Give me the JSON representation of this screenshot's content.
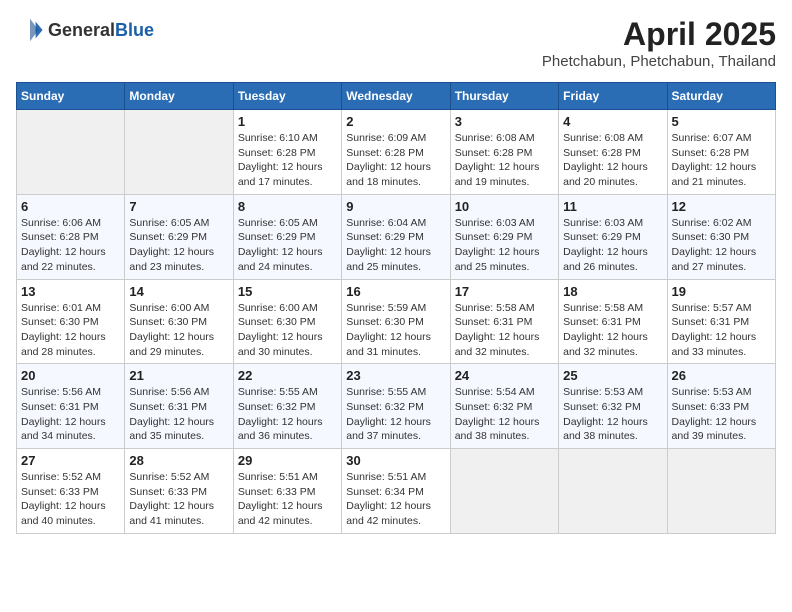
{
  "header": {
    "logo_general": "General",
    "logo_blue": "Blue",
    "title": "April 2025",
    "subtitle": "Phetchabun, Phetchabun, Thailand"
  },
  "calendar": {
    "weekdays": [
      "Sunday",
      "Monday",
      "Tuesday",
      "Wednesday",
      "Thursday",
      "Friday",
      "Saturday"
    ],
    "weeks": [
      [
        {
          "day": "",
          "sunrise": "",
          "sunset": "",
          "daylight": ""
        },
        {
          "day": "",
          "sunrise": "",
          "sunset": "",
          "daylight": ""
        },
        {
          "day": "1",
          "sunrise": "Sunrise: 6:10 AM",
          "sunset": "Sunset: 6:28 PM",
          "daylight": "Daylight: 12 hours and 17 minutes."
        },
        {
          "day": "2",
          "sunrise": "Sunrise: 6:09 AM",
          "sunset": "Sunset: 6:28 PM",
          "daylight": "Daylight: 12 hours and 18 minutes."
        },
        {
          "day": "3",
          "sunrise": "Sunrise: 6:08 AM",
          "sunset": "Sunset: 6:28 PM",
          "daylight": "Daylight: 12 hours and 19 minutes."
        },
        {
          "day": "4",
          "sunrise": "Sunrise: 6:08 AM",
          "sunset": "Sunset: 6:28 PM",
          "daylight": "Daylight: 12 hours and 20 minutes."
        },
        {
          "day": "5",
          "sunrise": "Sunrise: 6:07 AM",
          "sunset": "Sunset: 6:28 PM",
          "daylight": "Daylight: 12 hours and 21 minutes."
        }
      ],
      [
        {
          "day": "6",
          "sunrise": "Sunrise: 6:06 AM",
          "sunset": "Sunset: 6:28 PM",
          "daylight": "Daylight: 12 hours and 22 minutes."
        },
        {
          "day": "7",
          "sunrise": "Sunrise: 6:05 AM",
          "sunset": "Sunset: 6:29 PM",
          "daylight": "Daylight: 12 hours and 23 minutes."
        },
        {
          "day": "8",
          "sunrise": "Sunrise: 6:05 AM",
          "sunset": "Sunset: 6:29 PM",
          "daylight": "Daylight: 12 hours and 24 minutes."
        },
        {
          "day": "9",
          "sunrise": "Sunrise: 6:04 AM",
          "sunset": "Sunset: 6:29 PM",
          "daylight": "Daylight: 12 hours and 25 minutes."
        },
        {
          "day": "10",
          "sunrise": "Sunrise: 6:03 AM",
          "sunset": "Sunset: 6:29 PM",
          "daylight": "Daylight: 12 hours and 25 minutes."
        },
        {
          "day": "11",
          "sunrise": "Sunrise: 6:03 AM",
          "sunset": "Sunset: 6:29 PM",
          "daylight": "Daylight: 12 hours and 26 minutes."
        },
        {
          "day": "12",
          "sunrise": "Sunrise: 6:02 AM",
          "sunset": "Sunset: 6:30 PM",
          "daylight": "Daylight: 12 hours and 27 minutes."
        }
      ],
      [
        {
          "day": "13",
          "sunrise": "Sunrise: 6:01 AM",
          "sunset": "Sunset: 6:30 PM",
          "daylight": "Daylight: 12 hours and 28 minutes."
        },
        {
          "day": "14",
          "sunrise": "Sunrise: 6:00 AM",
          "sunset": "Sunset: 6:30 PM",
          "daylight": "Daylight: 12 hours and 29 minutes."
        },
        {
          "day": "15",
          "sunrise": "Sunrise: 6:00 AM",
          "sunset": "Sunset: 6:30 PM",
          "daylight": "Daylight: 12 hours and 30 minutes."
        },
        {
          "day": "16",
          "sunrise": "Sunrise: 5:59 AM",
          "sunset": "Sunset: 6:30 PM",
          "daylight": "Daylight: 12 hours and 31 minutes."
        },
        {
          "day": "17",
          "sunrise": "Sunrise: 5:58 AM",
          "sunset": "Sunset: 6:31 PM",
          "daylight": "Daylight: 12 hours and 32 minutes."
        },
        {
          "day": "18",
          "sunrise": "Sunrise: 5:58 AM",
          "sunset": "Sunset: 6:31 PM",
          "daylight": "Daylight: 12 hours and 32 minutes."
        },
        {
          "day": "19",
          "sunrise": "Sunrise: 5:57 AM",
          "sunset": "Sunset: 6:31 PM",
          "daylight": "Daylight: 12 hours and 33 minutes."
        }
      ],
      [
        {
          "day": "20",
          "sunrise": "Sunrise: 5:56 AM",
          "sunset": "Sunset: 6:31 PM",
          "daylight": "Daylight: 12 hours and 34 minutes."
        },
        {
          "day": "21",
          "sunrise": "Sunrise: 5:56 AM",
          "sunset": "Sunset: 6:31 PM",
          "daylight": "Daylight: 12 hours and 35 minutes."
        },
        {
          "day": "22",
          "sunrise": "Sunrise: 5:55 AM",
          "sunset": "Sunset: 6:32 PM",
          "daylight": "Daylight: 12 hours and 36 minutes."
        },
        {
          "day": "23",
          "sunrise": "Sunrise: 5:55 AM",
          "sunset": "Sunset: 6:32 PM",
          "daylight": "Daylight: 12 hours and 37 minutes."
        },
        {
          "day": "24",
          "sunrise": "Sunrise: 5:54 AM",
          "sunset": "Sunset: 6:32 PM",
          "daylight": "Daylight: 12 hours and 38 minutes."
        },
        {
          "day": "25",
          "sunrise": "Sunrise: 5:53 AM",
          "sunset": "Sunset: 6:32 PM",
          "daylight": "Daylight: 12 hours and 38 minutes."
        },
        {
          "day": "26",
          "sunrise": "Sunrise: 5:53 AM",
          "sunset": "Sunset: 6:33 PM",
          "daylight": "Daylight: 12 hours and 39 minutes."
        }
      ],
      [
        {
          "day": "27",
          "sunrise": "Sunrise: 5:52 AM",
          "sunset": "Sunset: 6:33 PM",
          "daylight": "Daylight: 12 hours and 40 minutes."
        },
        {
          "day": "28",
          "sunrise": "Sunrise: 5:52 AM",
          "sunset": "Sunset: 6:33 PM",
          "daylight": "Daylight: 12 hours and 41 minutes."
        },
        {
          "day": "29",
          "sunrise": "Sunrise: 5:51 AM",
          "sunset": "Sunset: 6:33 PM",
          "daylight": "Daylight: 12 hours and 42 minutes."
        },
        {
          "day": "30",
          "sunrise": "Sunrise: 5:51 AM",
          "sunset": "Sunset: 6:34 PM",
          "daylight": "Daylight: 12 hours and 42 minutes."
        },
        {
          "day": "",
          "sunrise": "",
          "sunset": "",
          "daylight": ""
        },
        {
          "day": "",
          "sunrise": "",
          "sunset": "",
          "daylight": ""
        },
        {
          "day": "",
          "sunrise": "",
          "sunset": "",
          "daylight": ""
        }
      ]
    ]
  }
}
